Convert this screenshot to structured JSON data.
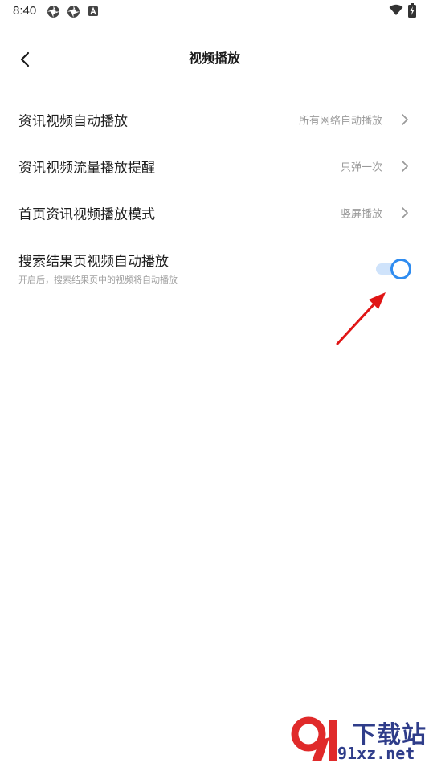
{
  "status_bar": {
    "time": "8:40",
    "icons": [
      "aperture-icon",
      "aperture-icon",
      "a-badge-icon",
      "wifi-icon",
      "battery-charging-icon"
    ]
  },
  "header": {
    "back_icon": "chevron-left-icon",
    "title": "视频播放"
  },
  "settings": [
    {
      "label": "资讯视频自动播放",
      "value": "所有网络自动播放"
    },
    {
      "label": "资讯视频流量播放提醒",
      "value": "只弹一次"
    },
    {
      "label": "首页资讯视频播放模式",
      "value": "竖屏播放"
    }
  ],
  "toggle_setting": {
    "label": "搜索结果页视频自动播放",
    "description": "开启后，搜索结果页中的视频将自动播放",
    "enabled": true
  },
  "colors": {
    "accent": "#2f8cf0",
    "track": "#cfe3fb",
    "annotation": "#e01515",
    "watermark_red": "#e02a2a",
    "watermark_blue": "#2f3d8a"
  },
  "watermark": {
    "brand": "下载站",
    "site": "91xz.net"
  }
}
